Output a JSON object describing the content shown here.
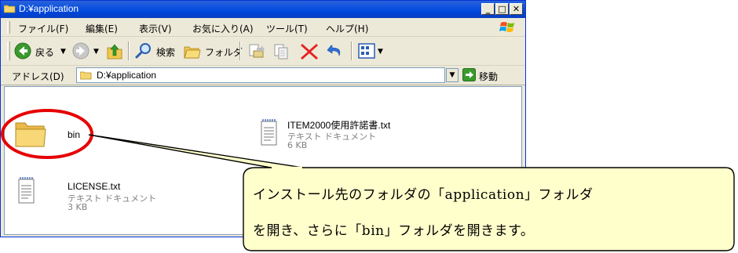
{
  "window": {
    "title": "D:¥application",
    "caption_buttons": {
      "minimize": "_",
      "maximize": "□",
      "close": "✕"
    }
  },
  "menu": {
    "items": [
      "ファイル(F)",
      "編集(E)",
      "表示(V)",
      "お気に入り(A)",
      "ツール(T)",
      "ヘルプ(H)"
    ]
  },
  "toolbar": {
    "back_label": "戻る",
    "search_label": "検索",
    "folders_label": "フォルダ"
  },
  "address": {
    "label": "アドレス(D)",
    "value": "D:¥application",
    "go_label": "移動"
  },
  "files": [
    {
      "name": "bin",
      "kind": "folder",
      "icon": "folder-icon"
    },
    {
      "name": "ITEM2000使用許諾書.txt",
      "type": "テキスト ドキュメント",
      "size": "6 KB",
      "icon": "text-document-icon"
    },
    {
      "name": "LICENSE.txt",
      "type": "テキスト ドキュメント",
      "size": "3 KB",
      "icon": "text-document-icon"
    }
  ],
  "callout": {
    "lines": [
      "インストール先のフォルダの「application」フォルダ",
      "を開き、さらに「bin」フォルダを開きます。"
    ],
    "fill": "#ffffcc",
    "highlight_color": "#e60000"
  },
  "colors": {
    "titlebar": "#0a54e0",
    "window_face": "#ece9d8"
  }
}
